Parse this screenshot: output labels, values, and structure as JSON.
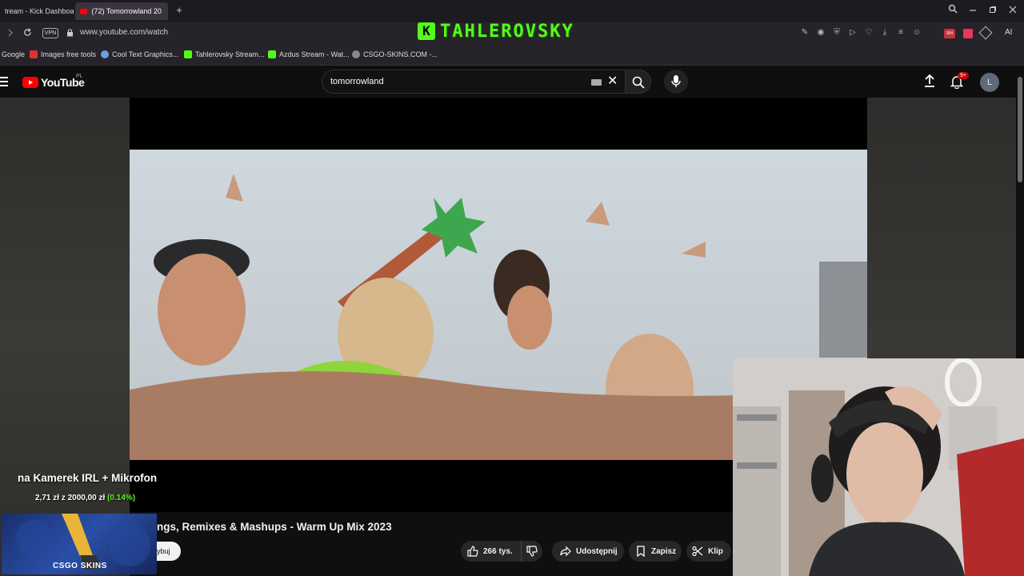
{
  "browser": {
    "tabs": [
      {
        "label": "tream - Kick Dashboard",
        "active": false
      },
      {
        "label": "(72) Tomorrowland 20",
        "active": true
      }
    ],
    "new_tab_symbol": "+",
    "url": "www.youtube.com/watch",
    "vpn_label": "VPN",
    "ai_label": "AI",
    "extension_badge": "304",
    "bookmarks": [
      {
        "label": "Google"
      },
      {
        "label": "Images free tools"
      },
      {
        "label": "Cool Text Graphics..."
      },
      {
        "label": "Tahlerovsky Stream..."
      },
      {
        "label": "Azdus Stream - Wat..."
      },
      {
        "label": "CSGO-SKINS.COM -..."
      }
    ]
  },
  "stream_overlay": {
    "channel_icon_letter": "K",
    "channel_name": "TAHLEROVSKY",
    "accent_color": "#53fc18"
  },
  "youtube": {
    "logo_text": "YouTube",
    "region": "PL",
    "search": {
      "query": "tomorrowland"
    },
    "notification_badge": "9+",
    "avatar_letter": "L",
    "video_title": "ngs, Remixes & Mashups - Warm Up Mix 2023",
    "subscribe_label": "ybuj",
    "actions": {
      "like_count": "266 tys.",
      "share_label": "Udostępnij",
      "save_label": "Zapisz",
      "clip_label": "Klip"
    }
  },
  "donation_goal": {
    "title": "na Kamerek IRL + Mikrofon",
    "current": "2,71 zł",
    "separator": "z",
    "goal": "2000,00 zł",
    "percent": "(0.14%)",
    "progress_fraction": 0.0014,
    "sponsor": "CSGO SKINS"
  }
}
